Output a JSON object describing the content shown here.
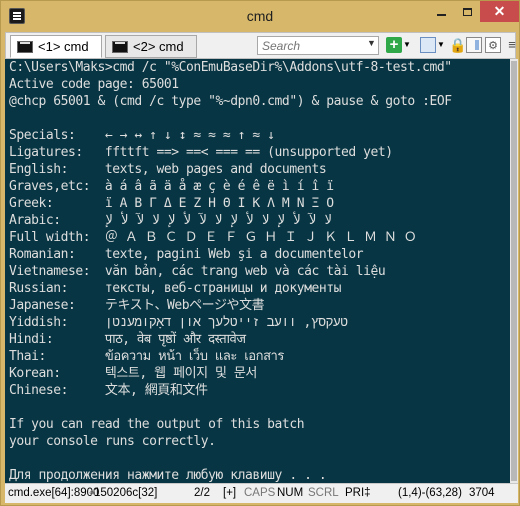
{
  "window": {
    "title": "cmd",
    "minimize_glyph": "",
    "close_glyph": "✕"
  },
  "tabs": [
    {
      "label": "<1> cmd",
      "active": true
    },
    {
      "label": "<2> cmd",
      "active": false
    }
  ],
  "toolbar": {
    "search_placeholder": "Search",
    "add_glyph": "+",
    "dropdown_glyph": "▼",
    "lock_glyph": "🔒",
    "settings_glyph": "⚙",
    "menu_glyph": "≡"
  },
  "console": {
    "lines": [
      "C:\\Users\\Maks>cmd /c \"%ConEmuBaseDir%\\Addons\\utf-8-test.cmd\"",
      "Active code page: 65001",
      "@chcp 65001 & (cmd /c type \"%~dpn0.cmd\") & pause & goto :EOF",
      "",
      "Specials:    ← → ↔ ↑ ↓ ↕ ≈ ≈ ≈ ↑ ≈ ↓",
      "Ligatures:   ffttft ==> ==< === == (unsupported yet)",
      "English:     texts, web pages and documents",
      "Graves,etc:  à á â ã ä å æ ç è é ê ë ì í î ï",
      "Greek:       ï Α Β Γ Δ Ε Ζ Η Θ Ι Κ Λ Μ Ν Ξ Ο",
      "Arabic:      ﻻ ﻵ ﻷ ﻹ ﻻ ﻷ ﻹ ﻻ ﻵ ﻷ ﻹ ﻻ ﻵ ﻷ ﻹ",
      "Full width:  ＠ Ａ Ｂ Ｃ Ｄ Ｅ Ｆ Ｇ Ｈ Ｉ Ｊ Ｋ Ｌ Ｍ Ｎ Ｏ",
      "Romanian:    texte, pagini Web şi a documentelor",
      "Vietnamese:  văn bản, các trang web và các tài liệu",
      "Russian:     тексты, веб-страницы и документы",
      "Japanese:    テキスト、Webページや文書",
      "Yiddish:     טעקסץ, וועב זייטלעך און דאָקומענטן",
      "Hindi:       पाठ, वेब पृष्ठों और दस्तावेज",
      "Thai:        ข้อความ หน้า เว็บ และ เอกสาร",
      "Korean:      텍스트, 웹 페이지 및 문서",
      "Chinese:     文本, 網頁和文件",
      "",
      "If you can read the output of this batch",
      "your console runs correctly.",
      "",
      "Для продолжения нажмите любую клавишу . . ."
    ]
  },
  "statusbar": {
    "process": "cmd.exe[64]:8900",
    "separator": "«",
    "console": "150206c[32]",
    "position": "2/2",
    "plus": "[+]",
    "caps": "CAPS",
    "num": "NUM",
    "scrl": "SCRL",
    "pri": "PRI‡",
    "cursor": "(1,4)-(63,28)",
    "size": "3704"
  }
}
